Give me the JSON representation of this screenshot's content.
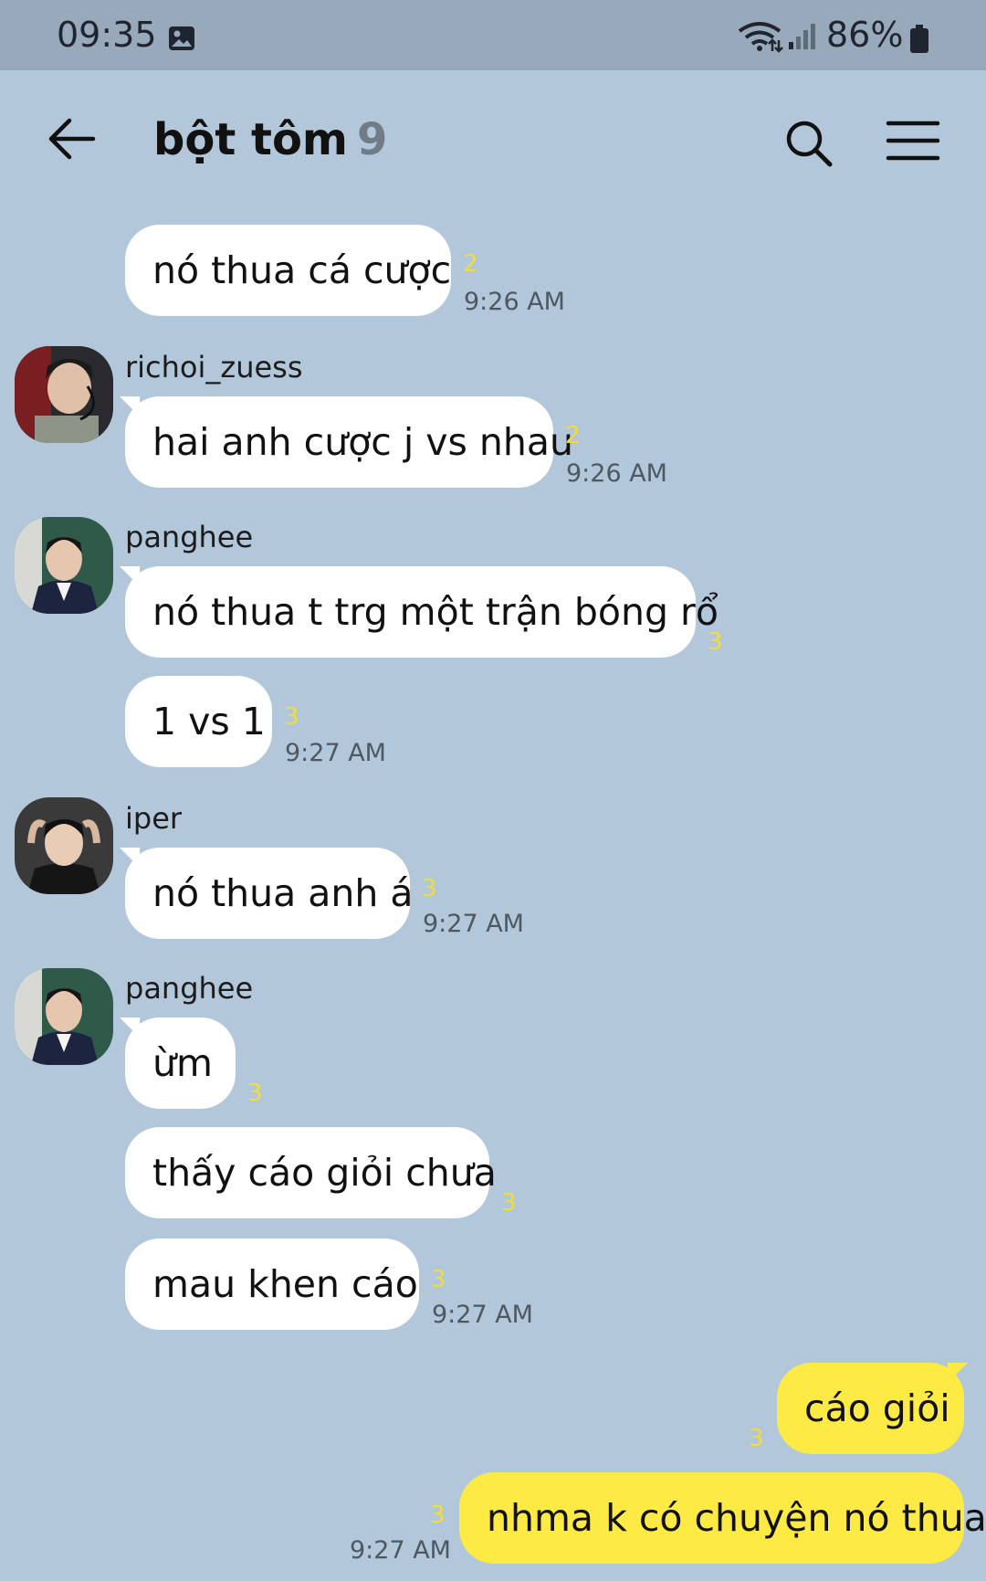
{
  "status_bar": {
    "time": "09:35",
    "battery": "86%"
  },
  "header": {
    "title": "bột tôm",
    "member_count": "9"
  },
  "senders": {
    "richoi": "richoi_zuess",
    "panghee": "panghee",
    "iper": "iper"
  },
  "messages": [
    {
      "text": "nó thua cá cược",
      "unread": "2",
      "time": "9:26 AM"
    },
    {
      "text": "hai anh cược j vs nhau",
      "unread": "2",
      "time": "9:26 AM"
    },
    {
      "text": "nó thua t trg một trận bóng rổ",
      "unread": "3"
    },
    {
      "text": "1 vs 1",
      "unread": "3",
      "time": "9:27 AM"
    },
    {
      "text": "nó thua anh á",
      "unread": "3",
      "time": "9:27 AM"
    },
    {
      "text": "ừm",
      "unread": "3"
    },
    {
      "text": "thấy cáo giỏi chưa",
      "unread": "3"
    },
    {
      "text": "mau khen cáo",
      "unread": "3",
      "time": "9:27 AM"
    },
    {
      "text": "cáo giỏi",
      "unread": "3"
    },
    {
      "text": "nhma k có chuyện nó thua",
      "unread": "3",
      "time": "9:27 AM"
    }
  ],
  "colors": {
    "background": "#b2c7da",
    "status_bar": "#98a9bb",
    "my_bubble": "#fdea45",
    "other_bubble": "#ffffff",
    "unread_count": "#f2dd38"
  }
}
